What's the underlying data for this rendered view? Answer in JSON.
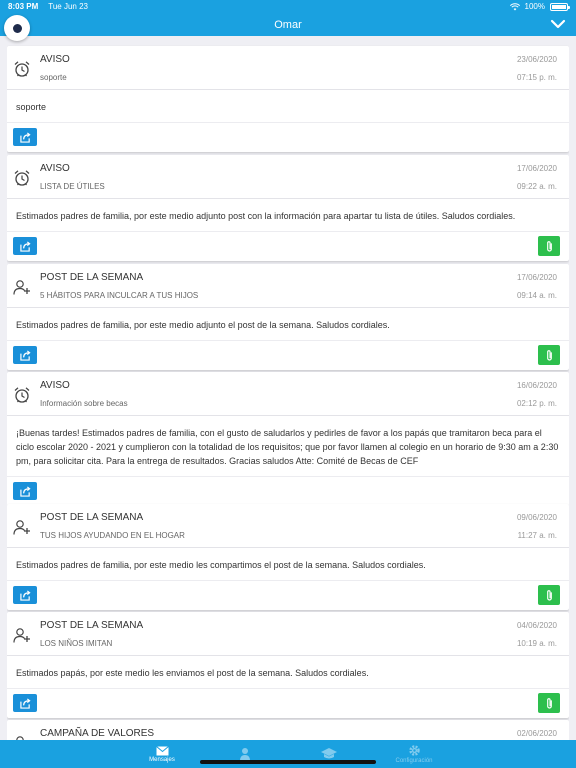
{
  "status_bar": {
    "time": "8:03 PM",
    "date": "Tue Jun 23",
    "battery": "100%"
  },
  "nav": {
    "title": "Omar"
  },
  "messages": [
    {
      "type": "alarm",
      "title": "AVISO",
      "subtitle": "soporte",
      "date": "23/06/2020",
      "time": "07:15 p. m.",
      "body": "soporte",
      "has_attachment": false
    },
    {
      "type": "alarm",
      "title": "AVISO",
      "subtitle": "LISTA DE ÚTILES",
      "date": "17/06/2020",
      "time": "09:22 a. m.",
      "body": "Estimados padres de familia, por este medio adjunto post con la información para apartar tu lista de útiles.  Saludos cordiales.",
      "has_attachment": true
    },
    {
      "type": "person-add",
      "title": "POST DE LA SEMANA",
      "subtitle": "5 HÁBITOS PARA INCULCAR A TUS HIJOS",
      "date": "17/06/2020",
      "time": "09:14 a. m.",
      "body": "Estimados padres de familia, por este medio adjunto el post de la semana. Saludos cordiales.",
      "has_attachment": true
    },
    {
      "type": "alarm",
      "title": "AVISO",
      "subtitle": "Información sobre becas",
      "date": "16/06/2020",
      "time": "02:12 p. m.",
      "body": "¡Buenas tardes!   Estimados padres de familia, con el gusto de saludarlos y pedirles de favor a los papás que tramitaron beca para el ciclo escolar 2020 - 2021 y cumplieron con la totalidad de los requisitos; que por favor llamen al colegio en un horario de 9:30 am a 2:30 pm, para solicitar cita. Para la entrega de resultados. Gracias saludos   Atte: Comité de Becas de CEF",
      "has_attachment": false
    },
    {
      "type": "person-add",
      "title": "POST DE LA SEMANA",
      "subtitle": "TUS HIJOS AYUDANDO EN EL HOGAR",
      "date": "09/06/2020",
      "time": "11:27 a. m.",
      "body": "Estimados padres de familia, por este medio les compartimos el post de la semana.  Saludos cordiales.",
      "has_attachment": true
    },
    {
      "type": "person-add",
      "title": "POST DE LA SEMANA",
      "subtitle": "LOS NIÑOS IMITAN",
      "date": "04/06/2020",
      "time": "10:19 a. m.",
      "body": "Estimados papás, por este medio les enviamos el post de la semana. Saludos cordiales.",
      "has_attachment": true
    },
    {
      "type": "person-add",
      "title": "CAMPAÑA DE VALORES",
      "subtitle": "",
      "date": "02/06/2020",
      "time": "",
      "body": "",
      "has_attachment": false
    }
  ],
  "tabs": [
    {
      "label": "Mensajes",
      "icon": "envelope-icon",
      "active": true
    },
    {
      "label": "",
      "icon": "person-icon",
      "active": false
    },
    {
      "label": "",
      "icon": "graduation-cap-icon",
      "active": false
    },
    {
      "label": "Configuración",
      "icon": "gear-icon",
      "active": false
    }
  ],
  "colors": {
    "primary": "#1aa1e0",
    "share_button": "#1a90d9",
    "attach_button": "#2dbf4d"
  }
}
